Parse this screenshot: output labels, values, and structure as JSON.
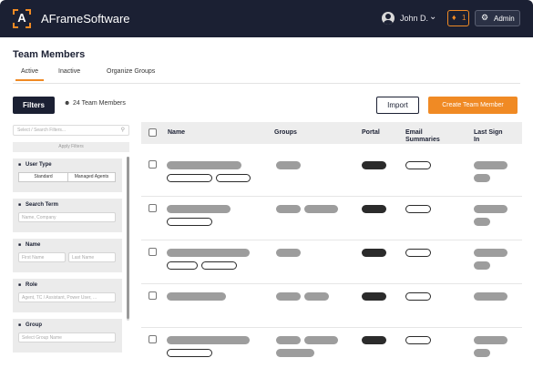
{
  "app": {
    "brand": "AFrameSoftware",
    "logo_letter": "A"
  },
  "header": {
    "user_name": "John D.",
    "notification_count": "1",
    "admin_label": "Admin"
  },
  "page": {
    "title": "Team Members",
    "tabs": [
      {
        "label": "Active",
        "active": true
      },
      {
        "label": "Inactive",
        "active": false
      },
      {
        "label": "Organize Groups",
        "active": false
      }
    ]
  },
  "toolbar": {
    "filters_label": "Filters",
    "members_count": "24 Team Members",
    "import_label": "Import",
    "create_label": "Create Team Member"
  },
  "filters": {
    "search_placeholder": "Select / Search Filters...",
    "apply_label": "Apply Filters",
    "user_type": {
      "title": "User Type",
      "options": [
        "Standard",
        "Managed Agents"
      ]
    },
    "search_term": {
      "title": "Search Term",
      "placeholder": "Name, Company"
    },
    "name": {
      "title": "Name",
      "first_placeholder": "First Name",
      "last_placeholder": "Last Name"
    },
    "role": {
      "title": "Role",
      "placeholder": "Agent, TC / Assistant, Power User, ..."
    },
    "group": {
      "title": "Group",
      "placeholder": "Select Group Name"
    }
  },
  "table": {
    "columns": [
      "Name",
      "Groups",
      "Portal",
      "Email Summaries",
      "Last Sign In"
    ],
    "rows": [
      {
        "name_tags": 2,
        "groups": 1
      },
      {
        "name_tags": 1,
        "groups": 2
      },
      {
        "name_tags": 2,
        "groups": 1
      },
      {
        "name_tags": 0,
        "groups": 2
      },
      {
        "name_tags": 1,
        "groups": 3
      }
    ]
  },
  "colors": {
    "accent": "#f08a24",
    "navy": "#1b2033"
  }
}
